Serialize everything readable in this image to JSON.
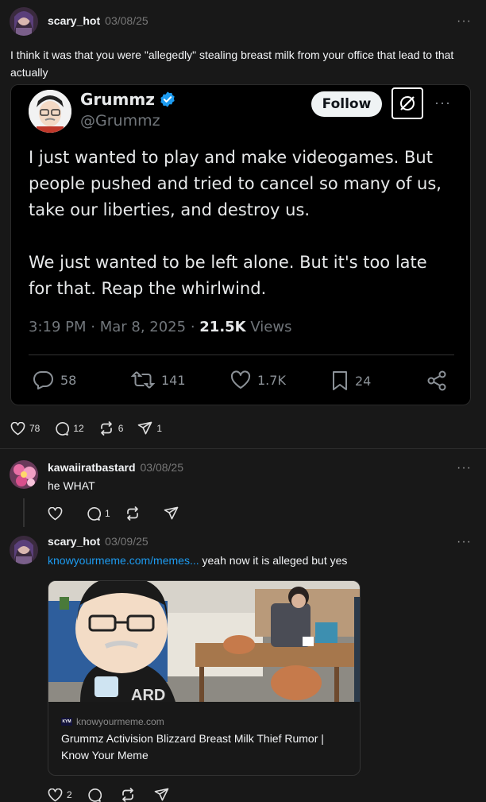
{
  "post1": {
    "username": "scary_hot",
    "date": "03/08/25",
    "text": "I think it was that you were \"allegedly\" stealing breast milk from your office that lead to that actually",
    "counts": {
      "likes": "78",
      "replies": "12",
      "reposts": "6",
      "shares": "1"
    }
  },
  "tweet": {
    "name": "Grummz",
    "handle": "@Grummz",
    "follow_label": "Follow",
    "text": "I just wanted to play and make videogames. But people pushed and tried to cancel so many of us, take our liberties, and destroy us.\n\nWe just wanted to be left alone. But it's too late for that. Reap the whirlwind.",
    "time": "3:19 PM",
    "date": "Mar 8, 2025",
    "views_count": "21.5K",
    "views_label": "Views",
    "replies": "58",
    "retweets": "141",
    "likes": "1.7K",
    "bookmarks": "24",
    "verified_color": "#1d9bf0"
  },
  "post2": {
    "username": "kawaiiratbastard",
    "date": "03/08/25",
    "text": "he WHAT",
    "counts": {
      "replies": "1"
    }
  },
  "post3": {
    "username": "scary_hot",
    "date": "03/09/25",
    "link_text": "knowyourmeme.com/memes...",
    "text": " yeah now it is alleged but yes",
    "card": {
      "favicon": "KYM",
      "domain": "knowyourmeme.com",
      "title": "Grummz Activision Blizzard Breast Milk Thief Rumor | Know Your Meme",
      "shirt_text": "ARD"
    },
    "counts": {
      "likes": "2"
    }
  },
  "more_label": "···"
}
